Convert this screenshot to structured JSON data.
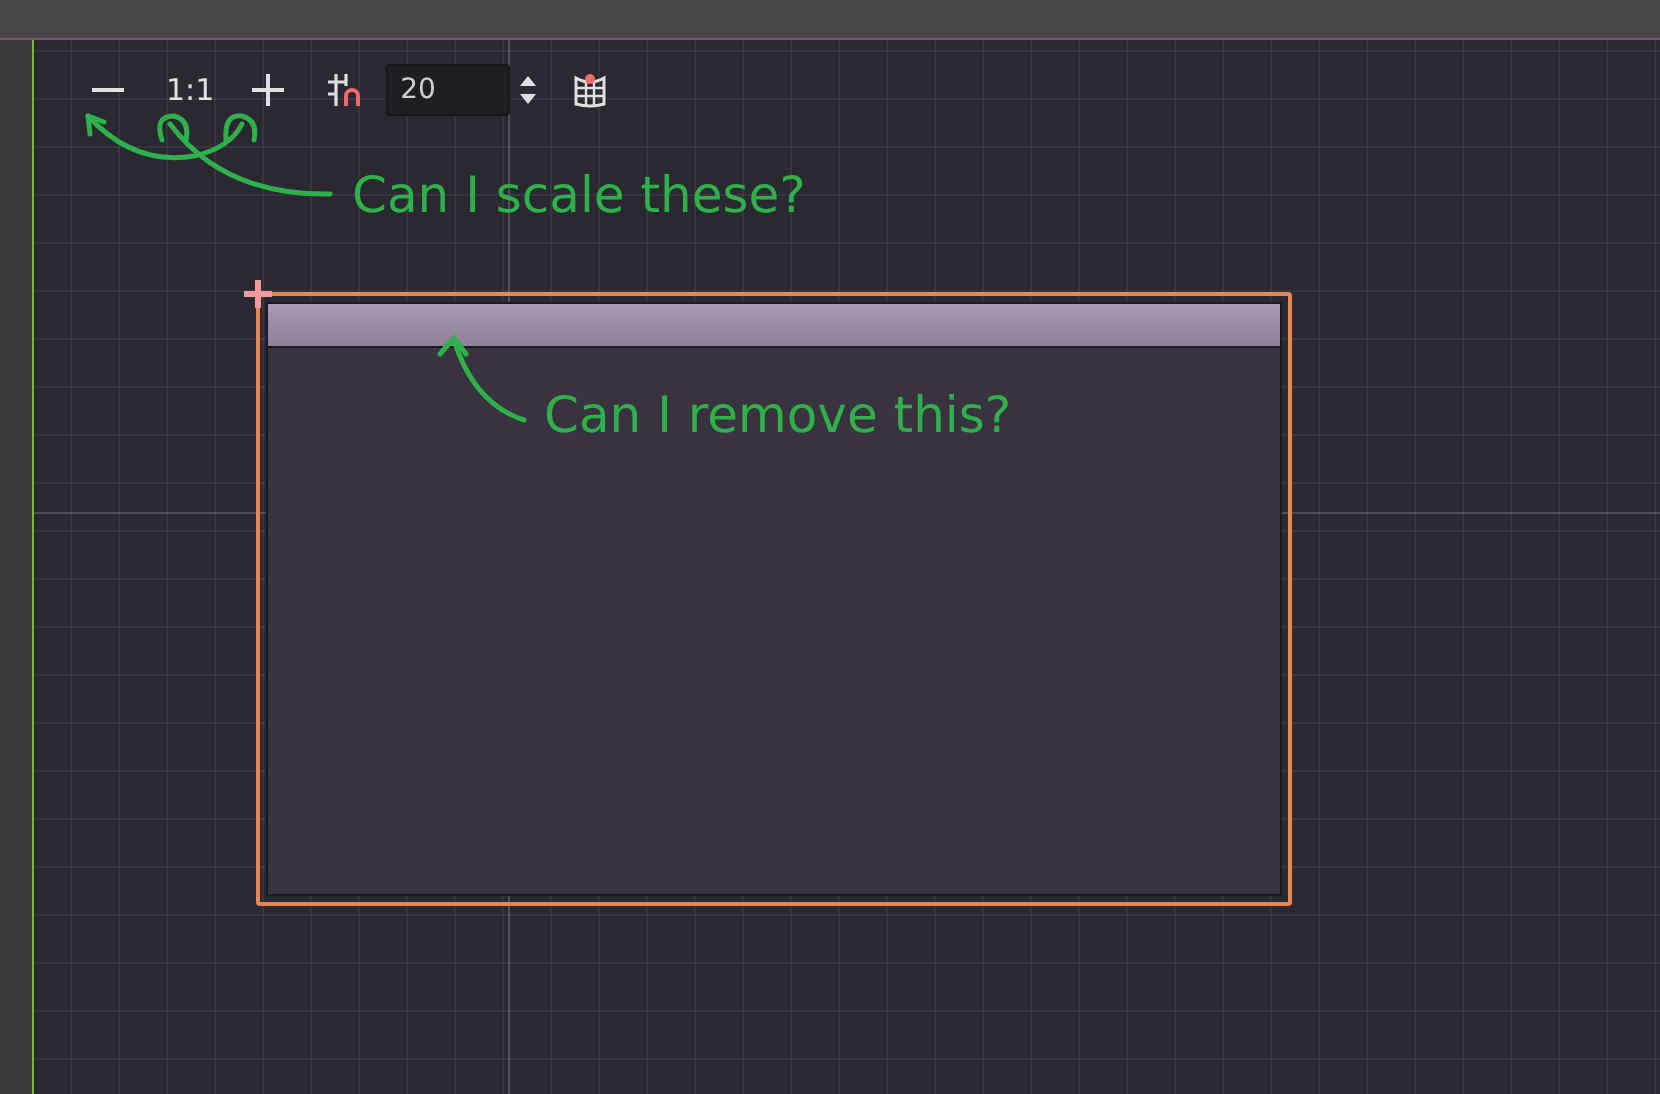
{
  "toolbar": {
    "zoom_reset_label": "1:1",
    "grid_step": "20"
  },
  "annotations": [
    {
      "text": "Can I scale these?"
    },
    {
      "text": "Can I remove this?"
    }
  ],
  "panel": {
    "selected": true
  }
}
